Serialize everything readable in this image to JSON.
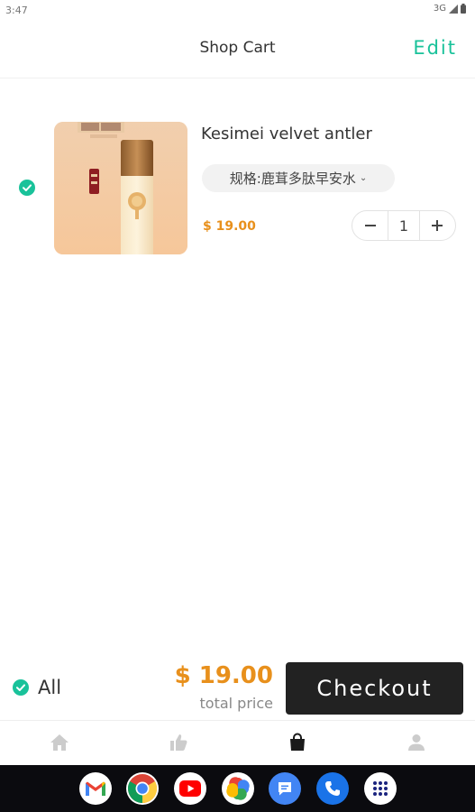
{
  "status_bar": {
    "time": "3:47",
    "network": "3G"
  },
  "header": {
    "title": "Shop Cart",
    "edit_label": "Edit"
  },
  "cart": {
    "items": [
      {
        "title": "Kesimei velvet antler",
        "spec": "规格:鹿茸多肽早安水",
        "price": "$ 19.00",
        "quantity": "1",
        "selected": true
      }
    ]
  },
  "checkout_bar": {
    "select_all_label": "All",
    "total_amount": "$ 19.00",
    "total_label": "total price",
    "checkout_label": "Checkout"
  },
  "tabs": [
    "home-icon",
    "thumbs-up-icon",
    "shopping-bag-icon",
    "profile-icon"
  ],
  "active_tab": "shopping-bag-icon",
  "nav_apps": [
    "gmail-icon",
    "chrome-icon",
    "youtube-icon",
    "photos-icon",
    "messages-icon",
    "phone-icon",
    "app-drawer-icon"
  ],
  "colors": {
    "accent_green": "#19c29a",
    "price_orange": "#e8901c",
    "checkout_bg": "#222222",
    "tab_inactive": "#cccccc",
    "tab_active": "#1a1a1a"
  }
}
